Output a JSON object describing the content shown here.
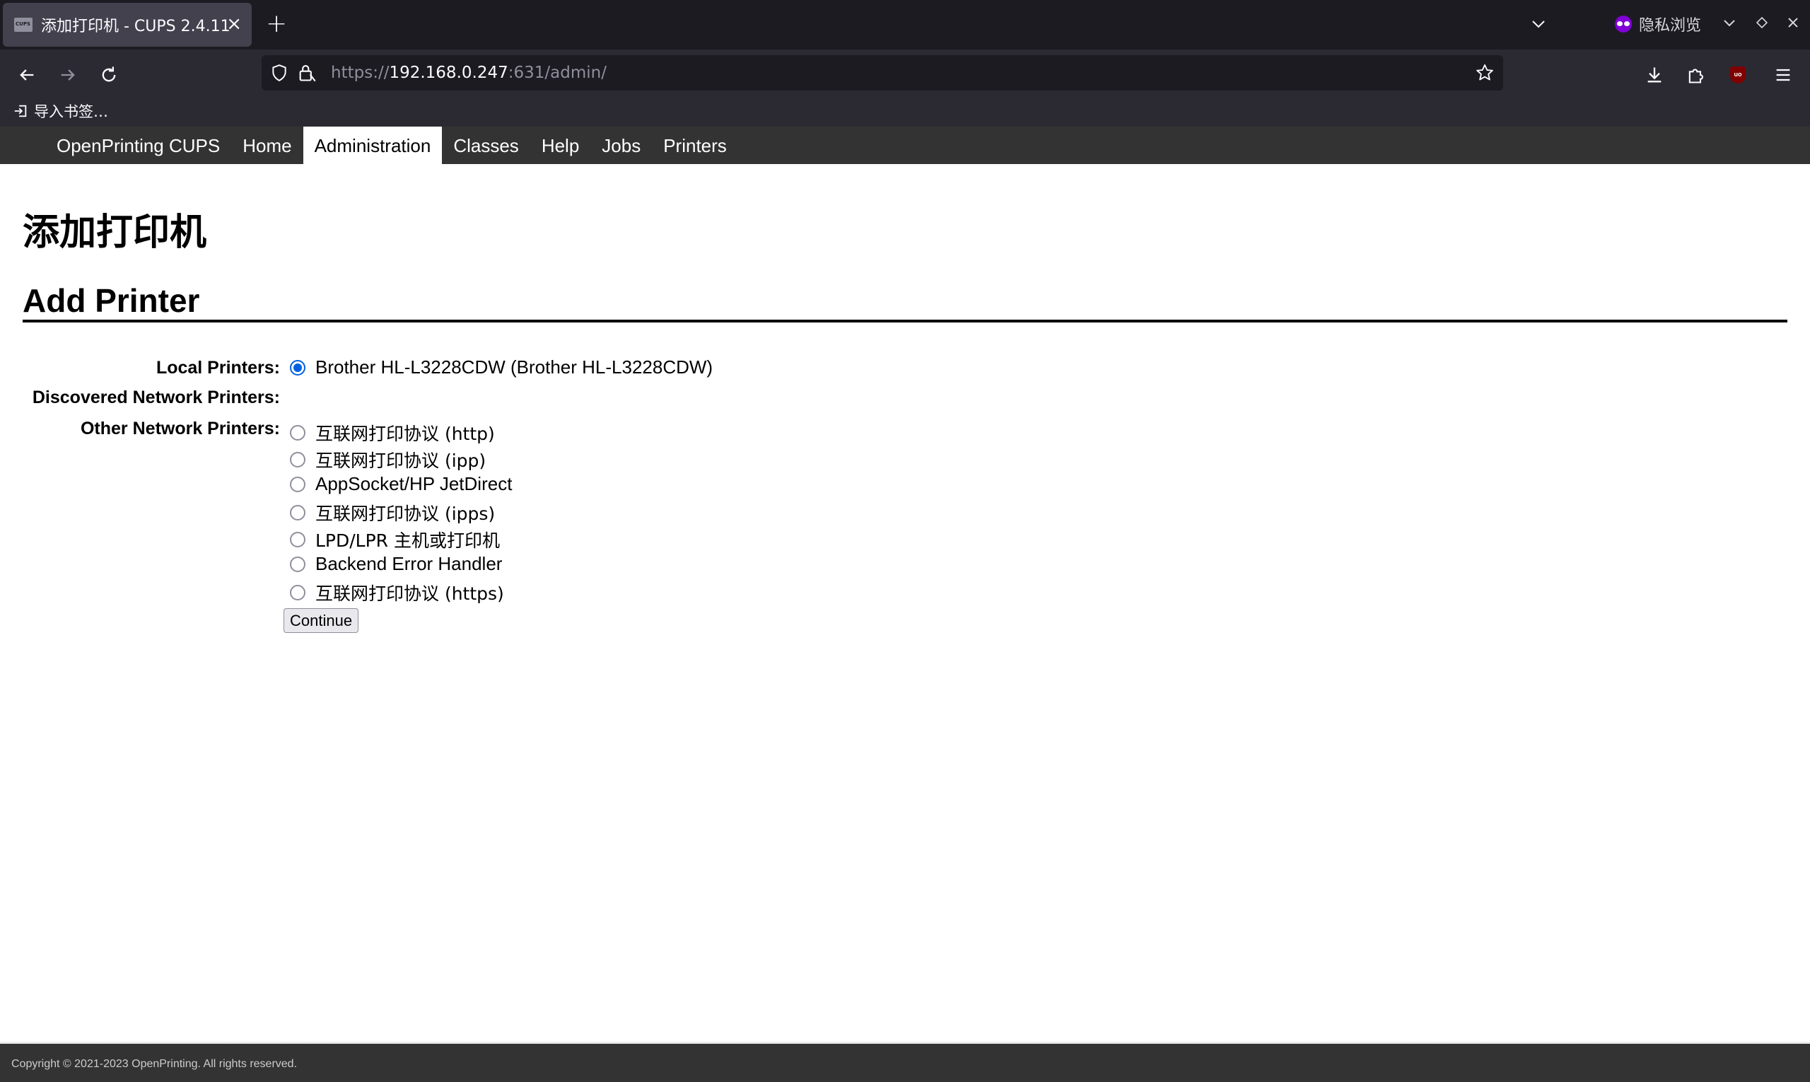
{
  "browser": {
    "tab": {
      "title": "添加打印机 - CUPS 2.4.11",
      "close_glyph": "×"
    },
    "new_tab_glyph": "+",
    "private_label": "隐私浏览",
    "url": {
      "scheme": "https://",
      "host": "192.168.0.247",
      "rest": ":631/admin/"
    },
    "bookmark_import_label": "导入书签…",
    "icons": [
      "back-icon",
      "forward-icon",
      "reload-icon",
      "shield-icon",
      "lock-icon",
      "star-icon",
      "download-icon",
      "extensions-icon",
      "ublock-icon",
      "menu-icon"
    ]
  },
  "cups": {
    "nav": [
      {
        "label": "OpenPrinting CUPS"
      },
      {
        "label": "Home"
      },
      {
        "label": "Administration",
        "active": true
      },
      {
        "label": "Classes"
      },
      {
        "label": "Help"
      },
      {
        "label": "Jobs"
      },
      {
        "label": "Printers"
      }
    ],
    "heading_cn": "添加打印机",
    "heading_en": "Add Printer",
    "form": {
      "local_label": "Local Printers:",
      "discovered_label": "Discovered Network Printers:",
      "other_label": "Other Network Printers:",
      "local_printers": [
        {
          "label": "Brother HL-L3228CDW (Brother HL-L3228CDW)",
          "checked": true
        }
      ],
      "other_printers": [
        {
          "label": "互联网打印协议 (http)",
          "checked": false
        },
        {
          "label": "互联网打印协议 (ipp)",
          "checked": false
        },
        {
          "label": "AppSocket/HP JetDirect",
          "checked": false
        },
        {
          "label": "互联网打印协议 (ipps)",
          "checked": false
        },
        {
          "label": "LPD/LPR 主机或打印机",
          "checked": false
        },
        {
          "label": "Backend Error Handler",
          "checked": false
        },
        {
          "label": "互联网打印协议 (https)",
          "checked": false
        }
      ],
      "continue_label": "Continue"
    },
    "footer": "Copyright © 2021-2023 OpenPrinting. All rights reserved."
  },
  "colors": {
    "accent": "#0060df",
    "header_bg": "#333333",
    "chrome_bg": "#2b2a33",
    "tabbar_bg": "#1c1b22"
  }
}
